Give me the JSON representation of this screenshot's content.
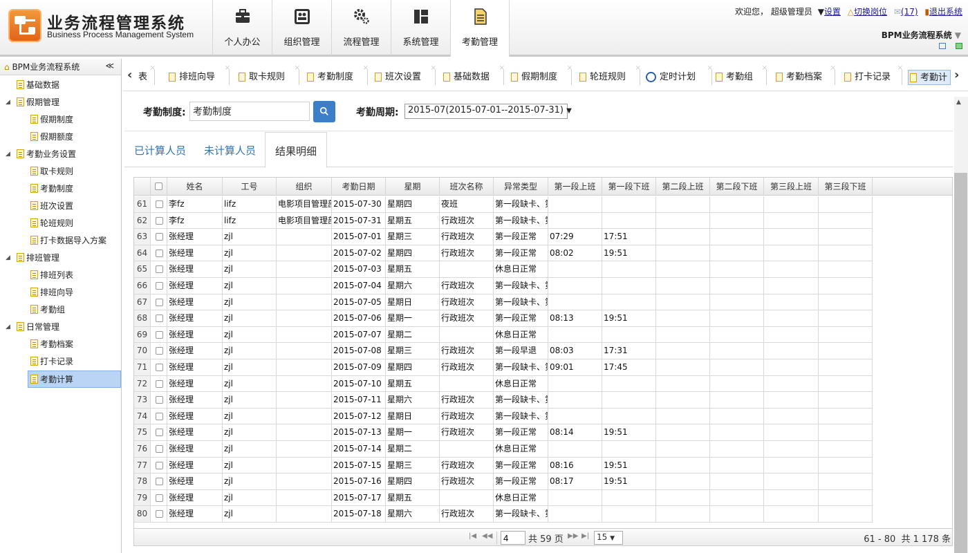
{
  "header": {
    "title": "业务流程管理系统",
    "subtitle": "Business Process Management System",
    "menu": [
      {
        "label": "个人办公",
        "icon": "briefcase-icon"
      },
      {
        "label": "组织管理",
        "icon": "org-chart-icon"
      },
      {
        "label": "流程管理",
        "icon": "gears-icon"
      },
      {
        "label": "系统管理",
        "icon": "panel-icon"
      },
      {
        "label": "考勤管理",
        "icon": "document-icon",
        "active": true
      }
    ],
    "welcome": "欢迎您，",
    "user": "超级管理员",
    "settings": "设置",
    "switch_post": "切换岗位",
    "mail_count": "(17)",
    "logout": "退出系统",
    "system_select": "BPM业务流程系统"
  },
  "sidebar": {
    "title": "BPM业务流程系统",
    "collapse": "≪",
    "items": [
      {
        "label": "基础数据",
        "level": 0,
        "group": false
      },
      {
        "label": "假期管理",
        "level": 0,
        "group": true
      },
      {
        "label": "假期制度",
        "level": 1
      },
      {
        "label": "假期额度",
        "level": 1
      },
      {
        "label": "考勤业务设置",
        "level": 0,
        "group": true
      },
      {
        "label": "取卡规则",
        "level": 1
      },
      {
        "label": "考勤制度",
        "level": 1
      },
      {
        "label": "班次设置",
        "level": 1
      },
      {
        "label": "轮班规则",
        "level": 1
      },
      {
        "label": "打卡数据导入方案",
        "level": 1
      },
      {
        "label": "排班管理",
        "level": 0,
        "group": true
      },
      {
        "label": "排班列表",
        "level": 1
      },
      {
        "label": "排班向导",
        "level": 1
      },
      {
        "label": "考勤组",
        "level": 1
      },
      {
        "label": "日常管理",
        "level": 0,
        "group": true
      },
      {
        "label": "考勤档案",
        "level": 1
      },
      {
        "label": "打卡记录",
        "level": 1
      },
      {
        "label": "考勤计算",
        "level": 1,
        "selected": true
      }
    ]
  },
  "tabs": [
    {
      "label": "表",
      "icon": "none"
    },
    {
      "label": "排班向导",
      "icon": "document-icon"
    },
    {
      "label": "取卡规则",
      "icon": "document-icon"
    },
    {
      "label": "考勤制度",
      "icon": "document-icon"
    },
    {
      "label": "班次设置",
      "icon": "document-icon"
    },
    {
      "label": "基础数据",
      "icon": "document-icon"
    },
    {
      "label": "假期制度",
      "icon": "document-icon"
    },
    {
      "label": "轮班规则",
      "icon": "document-icon"
    },
    {
      "label": "定时计划",
      "icon": "clock-icon"
    },
    {
      "label": "考勤组",
      "icon": "document-icon"
    },
    {
      "label": "考勤档案",
      "icon": "document-icon"
    },
    {
      "label": "打卡记录",
      "icon": "document-icon"
    },
    {
      "label": "考勤计",
      "icon": "document-icon",
      "current": true
    }
  ],
  "form": {
    "policy_label": "考勤制度:",
    "policy_value": "考勤制度",
    "period_label": "考勤周期:",
    "period_value": "2015-07(2015-07-01--2015-07-31)"
  },
  "subtabs": [
    "已计算人员",
    "未计算人员",
    "结果明细"
  ],
  "table": {
    "columns": [
      "姓名",
      "工号",
      "组织",
      "考勤日期",
      "星期",
      "班次名称",
      "异常类型",
      "第一段上班",
      "第一段下班",
      "第二段上班",
      "第二段下班",
      "第三段上班",
      "第三段下班"
    ],
    "rows": [
      [
        "61",
        "李fz",
        "lifz",
        "电影项目管理部",
        "2015-07-30",
        "星期四",
        "夜班",
        "第一段缺卡、第",
        "",
        ""
      ],
      [
        "62",
        "李fz",
        "lifz",
        "电影项目管理部",
        "2015-07-31",
        "星期五",
        "行政班次",
        "第一段缺卡、第",
        "",
        ""
      ],
      [
        "63",
        "张经理",
        "zjl",
        "",
        "2015-07-01",
        "星期三",
        "行政班次",
        "第一段正常",
        "07:29",
        "17:51"
      ],
      [
        "64",
        "张经理",
        "zjl",
        "",
        "2015-07-02",
        "星期四",
        "行政班次",
        "第一段正常",
        "08:02",
        "19:51"
      ],
      [
        "65",
        "张经理",
        "zjl",
        "",
        "2015-07-03",
        "星期五",
        "",
        "休息日正常",
        "",
        ""
      ],
      [
        "66",
        "张经理",
        "zjl",
        "",
        "2015-07-04",
        "星期六",
        "行政班次",
        "第一段缺卡、第",
        "",
        ""
      ],
      [
        "67",
        "张经理",
        "zjl",
        "",
        "2015-07-05",
        "星期日",
        "行政班次",
        "第一段缺卡、第",
        "",
        ""
      ],
      [
        "68",
        "张经理",
        "zjl",
        "",
        "2015-07-06",
        "星期一",
        "行政班次",
        "第一段正常",
        "08:13",
        "19:51"
      ],
      [
        "69",
        "张经理",
        "zjl",
        "",
        "2015-07-07",
        "星期二",
        "",
        "休息日正常",
        "",
        ""
      ],
      [
        "70",
        "张经理",
        "zjl",
        "",
        "2015-07-08",
        "星期三",
        "行政班次",
        "第一段早退",
        "08:03",
        "17:31"
      ],
      [
        "71",
        "张经理",
        "zjl",
        "",
        "2015-07-09",
        "星期四",
        "行政班次",
        "第一段缺卡、第",
        "09:01",
        "17:45"
      ],
      [
        "72",
        "张经理",
        "zjl",
        "",
        "2015-07-10",
        "星期五",
        "",
        "休息日正常",
        "",
        ""
      ],
      [
        "73",
        "张经理",
        "zjl",
        "",
        "2015-07-11",
        "星期六",
        "行政班次",
        "第一段缺卡、第",
        "",
        ""
      ],
      [
        "74",
        "张经理",
        "zjl",
        "",
        "2015-07-12",
        "星期日",
        "行政班次",
        "第一段缺卡、第",
        "",
        ""
      ],
      [
        "75",
        "张经理",
        "zjl",
        "",
        "2015-07-13",
        "星期一",
        "行政班次",
        "第一段正常",
        "08:14",
        "19:51"
      ],
      [
        "76",
        "张经理",
        "zjl",
        "",
        "2015-07-14",
        "星期二",
        "",
        "休息日正常",
        "",
        ""
      ],
      [
        "77",
        "张经理",
        "zjl",
        "",
        "2015-07-15",
        "星期三",
        "行政班次",
        "第一段正常",
        "08:16",
        "19:51"
      ],
      [
        "78",
        "张经理",
        "zjl",
        "",
        "2015-07-16",
        "星期四",
        "行政班次",
        "第一段正常",
        "08:17",
        "19:51"
      ],
      [
        "79",
        "张经理",
        "zjl",
        "",
        "2015-07-17",
        "星期五",
        "",
        "休息日正常",
        "",
        ""
      ],
      [
        "80",
        "张经理",
        "zjl",
        "",
        "2015-07-18",
        "星期六",
        "行政班次",
        "第一段缺卡、第",
        "",
        ""
      ]
    ]
  },
  "pager": {
    "page": "4",
    "total_pages": "共 59 页",
    "page_size": "15",
    "summary": "61 - 80  共 1 178 条"
  },
  "colors": {
    "accent": "#3a7fc7",
    "link": "#2f73b8",
    "selected": "#b9d4f5",
    "logo": "#e8782a"
  }
}
